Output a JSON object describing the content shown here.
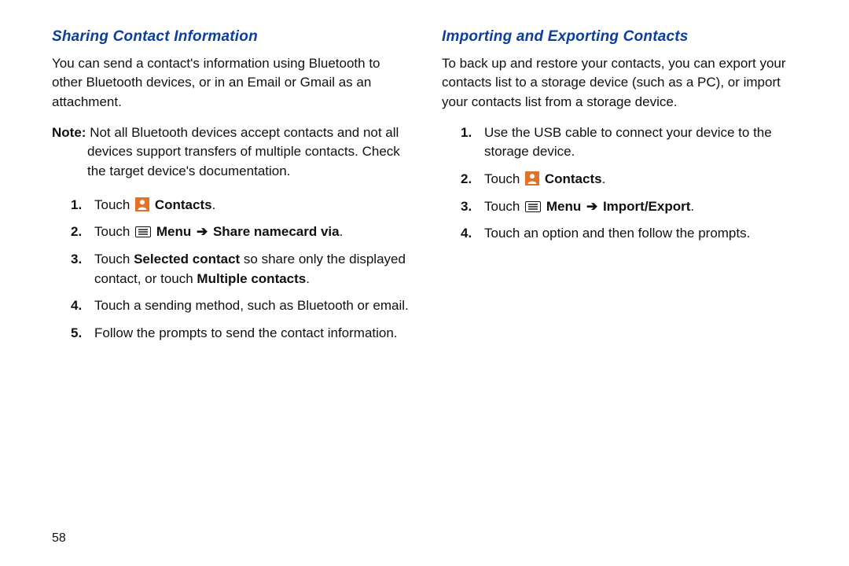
{
  "page_number": "58",
  "arrow": "➔",
  "left": {
    "heading": "Sharing Contact Information",
    "intro": "You can send a contact's information using Bluetooth to other Bluetooth devices, or in an Email or Gmail as an attachment.",
    "note_label": "Note:",
    "note_body": "Not all Bluetooth devices accept contacts and not all devices support transfers of multiple contacts. Check the target device's documentation.",
    "steps": {
      "s1_pre": "Touch ",
      "s1_post": " ",
      "s1_label": "Contacts",
      "s1_end": ".",
      "s2_pre": "Touch ",
      "s2_menu": "Menu",
      "s2_post": "Share namecard via",
      "s2_end": ".",
      "s3_pre": "Touch ",
      "s3_bold1": "Selected contact",
      "s3_mid": " so share only the displayed contact, or touch ",
      "s3_bold2": "Multiple contacts",
      "s3_end": ".",
      "s4": "Touch a sending method, such as Bluetooth or email.",
      "s5": "Follow the prompts to send the contact information."
    }
  },
  "right": {
    "heading": "Importing and Exporting Contacts",
    "intro": "To back up and restore your contacts, you can export your contacts list to a storage device (such as a PC), or import your contacts list from a storage device.",
    "steps": {
      "s1": "Use the USB cable to connect your device to the storage device.",
      "s2_pre": "Touch ",
      "s2_label": "Contacts",
      "s2_end": ".",
      "s3_pre": "Touch ",
      "s3_menu": "Menu",
      "s3_post": "Import/Export",
      "s3_end": ".",
      "s4": "Touch an option and then follow the prompts."
    }
  }
}
